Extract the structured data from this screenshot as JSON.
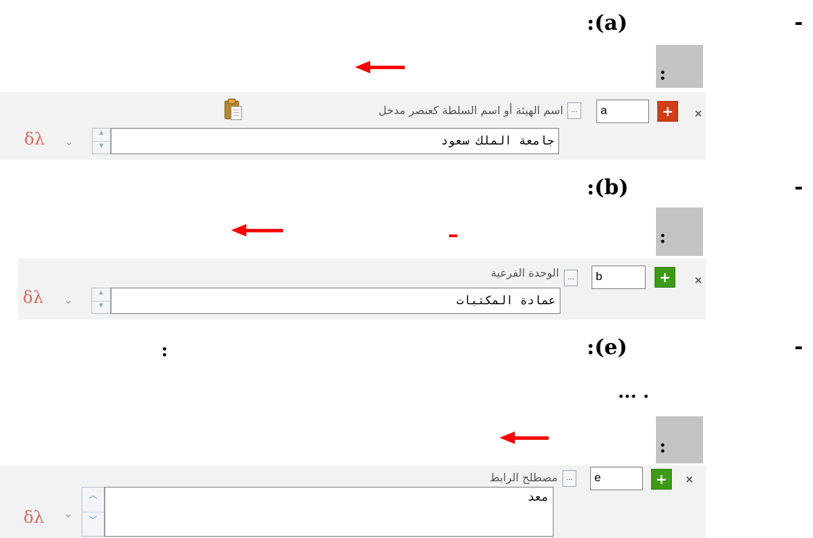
{
  "sections": [
    {
      "bullet": "-",
      "label": ":(a)",
      "colon": ":",
      "subfield": {
        "close_icon": "×",
        "add_icon": "+",
        "add_color": "#d03d17",
        "code": "a",
        "more_label": "...",
        "field_label": "اسم الهيئة أو اسم السلطة كعنصر مدخل",
        "value": "جامعة الملك سعود",
        "special_chars": "δλ",
        "dropdown_icon": "⌄"
      }
    },
    {
      "bullet": "-",
      "label": ":(b)",
      "colon": ":",
      "subfield": {
        "close_icon": "×",
        "add_icon": "+",
        "add_color": "#3d9a16",
        "code": "b",
        "more_label": "...",
        "field_label": "الوحدة الفرعية",
        "value": "عمادة المكتبات",
        "special_chars": "δλ",
        "dropdown_icon": "⌄"
      }
    },
    {
      "bullet": "-",
      "label": ":(e)",
      "inline_colon": ":",
      "ellipsis": "... .",
      "colon": ":",
      "subfield": {
        "close_icon": "×",
        "add_icon": "+",
        "add_color": "#3d9a16",
        "code": "e",
        "more_label": "...",
        "field_label": "مصطلح الرابط",
        "value": "معد",
        "special_chars": "δλ",
        "dropdown_icon": "⌄"
      }
    }
  ],
  "colors": {
    "arrow": "#ff0000",
    "highlight": "#c3c3c3",
    "panel": "#f2f2f2"
  }
}
